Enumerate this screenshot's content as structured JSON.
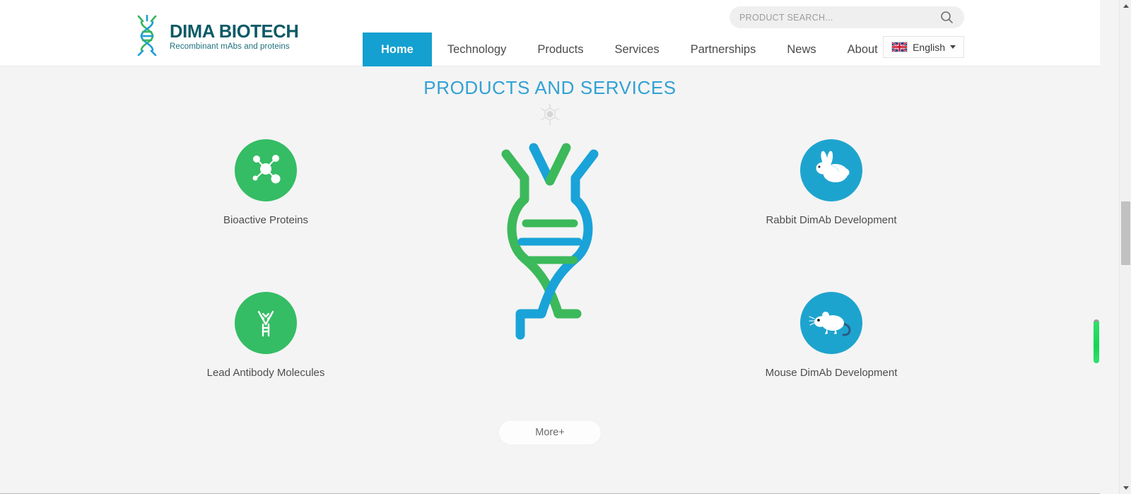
{
  "header": {
    "logo": {
      "icon": "dna-logo-icon",
      "title": "DIMA BIOTECH",
      "subtitle": "Recombinant mAbs and proteins"
    },
    "nav": [
      {
        "label": "Home",
        "active": true
      },
      {
        "label": "Technology",
        "active": false
      },
      {
        "label": "Products",
        "active": false
      },
      {
        "label": "Services",
        "active": false
      },
      {
        "label": "Partnerships",
        "active": false
      },
      {
        "label": "News",
        "active": false
      },
      {
        "label": "About",
        "active": false
      }
    ],
    "search": {
      "placeholder": "PRODUCT SEARCH...",
      "value": "",
      "icon": "search-icon"
    },
    "language": {
      "flag": "uk-flag-icon",
      "label": "English",
      "caret": "chevron-down-icon"
    }
  },
  "main": {
    "section_title": "PRODUCTS AND SERVICES",
    "section_decoration_icon": "virus-cell-icon",
    "center_graphic_icon": "dna-helix-icon",
    "features": [
      {
        "label": "Bioactive Proteins",
        "icon": "molecule-icon",
        "color": "#34bd64"
      },
      {
        "label": "Lead Antibody Molecules",
        "icon": "antibody-icon",
        "color": "#34bd64"
      },
      {
        "label": "Rabbit DimAb Development",
        "icon": "rabbit-icon",
        "color": "#1da4ce"
      },
      {
        "label": "Mouse DimAb Development",
        "icon": "mouse-icon",
        "color": "#1da4ce"
      }
    ],
    "more_button": "More+"
  },
  "colors": {
    "accent_blue": "#14a0d0",
    "title_blue": "#32a1d4",
    "green": "#34bd64",
    "blue": "#1da4ce",
    "page_bg": "#f4f4f4",
    "header_bg": "#ffffff",
    "scroll_thumb_green": "#19d455"
  }
}
